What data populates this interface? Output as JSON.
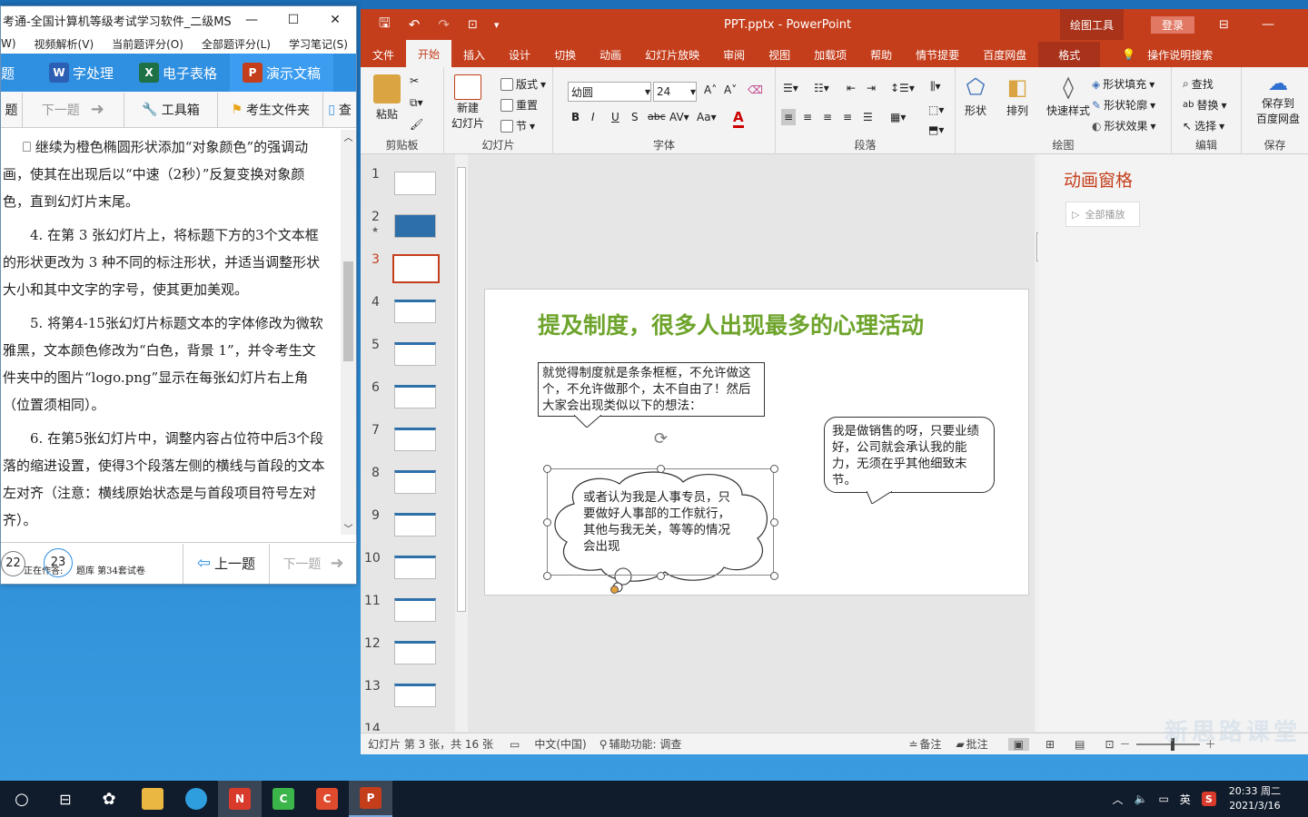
{
  "left_window": {
    "title": "考通-全国计算机等级考试学习软件_二级MS ...",
    "menu": [
      "W)",
      "视频解析(V)",
      "当前题评分(O)",
      "全部题评分(L)",
      "学习笔记(S)"
    ],
    "tools": [
      {
        "label": "字处理",
        "icon": "W",
        "color": "#2b5fb3"
      },
      {
        "label": "电子表格",
        "icon": "X",
        "color": "#1e7145"
      },
      {
        "label": "演示文稿",
        "icon": "P",
        "color": "#c43e1c"
      }
    ],
    "first_tool_label": "题",
    "nav": {
      "prev_partial": "题",
      "next": "下一题",
      "toolbox": "工具箱",
      "folder": "考生文件夹",
      "search_partial": "查"
    },
    "paragraphs": [
      "⎕ 继续为橙色椭圆形状添加“对象颜色”的强调动画，使其在出现后以“中速（2秒）”反复变换对象颜色，直到幻灯片末尾。",
      "4. 在第 3 张幻灯片上，将标题下方的3个文本框的形状更改为 3 种不同的标注形状，并适当调整形状大小和其中文字的字号，使其更加美观。",
      "5. 将第4-15张幻灯片标题文本的字体修改为微软雅黑，文本颜色修改为“白色，背景 1”，并令考生文件夹中的图片“logo.png”显示在每张幻灯片右上角（位置须相同）。",
      "6. 在第5张幻灯片中，调整内容占位符中后3个段落的缩进设置，使得3个段落左侧的横线与首段的文本左对齐（注意：横线原始状态是与首段项目符号左对齐）。"
    ],
    "bottom": {
      "c1": "22",
      "c2": "23",
      "info1": "正在作答:",
      "info2": "题库  第34套试卷",
      "prev": "上一题",
      "next": "下一题"
    }
  },
  "ppt": {
    "title": "PPT.pptx  -  PowerPoint",
    "drawing_tools": "绘图工具",
    "login": "登录",
    "tabs": [
      "文件",
      "开始",
      "插入",
      "设计",
      "切换",
      "动画",
      "幻灯片放映",
      "审阅",
      "视图",
      "加载项",
      "帮助",
      "情节提要",
      "百度网盘",
      "格式"
    ],
    "active_tab": "开始",
    "search_hint": "操作说明搜索",
    "groups": {
      "clipboard": {
        "label": "剪贴板",
        "paste": "粘贴"
      },
      "slides": {
        "label": "幻灯片",
        "new": "新建",
        "new2": "幻灯片",
        "layout": "版式",
        "reset": "重置",
        "section": "节"
      },
      "font": {
        "label": "字体",
        "name": "幼圆",
        "size": "24"
      },
      "paragraph": {
        "label": "段落"
      },
      "drawing": {
        "label": "绘图",
        "shape": "形状",
        "arrange": "排列",
        "quick": "快速样式",
        "fill": "形状填充",
        "outline": "形状轮廓",
        "effect": "形状效果"
      },
      "editing": {
        "label": "编辑",
        "find": "查找",
        "replace": "替换",
        "select": "选择"
      },
      "save": {
        "label": "保存",
        "btn1": "保存到",
        "btn2": "百度网盘"
      }
    },
    "thumbnails": [
      "1",
      "2",
      "3",
      "4",
      "5",
      "6",
      "7",
      "8",
      "9",
      "10",
      "11",
      "12",
      "13",
      "14"
    ],
    "thumb_star": "★",
    "selected_slide": 3,
    "slide": {
      "title": "提及制度，很多人出现最多的心理活动",
      "box1": "就觉得制度就是条条框框，不允许做这个，不允许做那个，太不自由了！然后大家会出现类似以下的想法：",
      "box2": "我是做销售的呀，只要业绩好，公司就会承认我的能力，无须在乎其他细致末节。",
      "cloud": "或者认为我是人事专员，只要做好人事部的工作就行，其他与我无关，等等的情况会出现"
    },
    "anim_pane": {
      "title": "动画窗格",
      "play_all": "全部播放"
    },
    "status": {
      "slide_info": "幻灯片 第 3 张，共 16 张",
      "lang": "中文(中国)",
      "access": "辅助功能: 调查",
      "notes": "备注",
      "comments": "批注"
    }
  },
  "taskbar": {
    "time": "20:33 周二",
    "date": "2021/3/16",
    "ime": "英"
  },
  "watermark": "新思路课堂"
}
